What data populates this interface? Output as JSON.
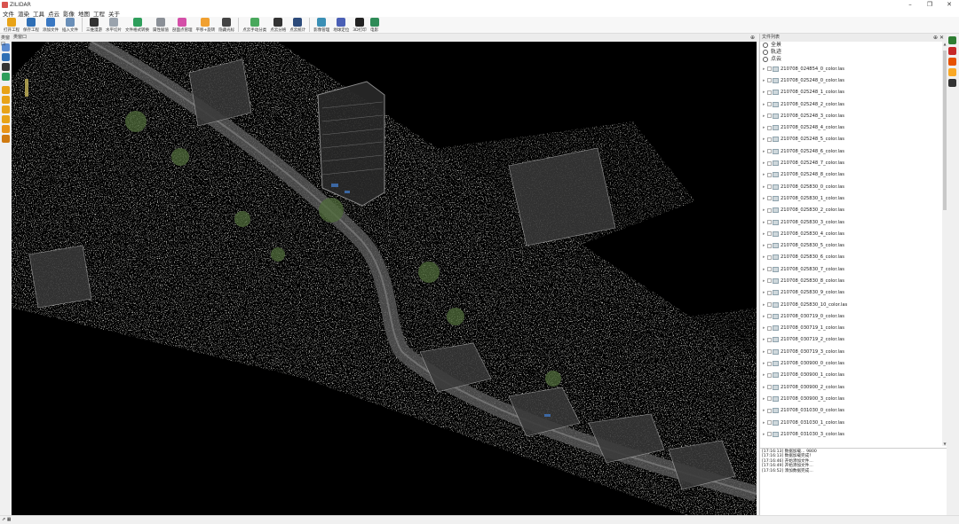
{
  "window": {
    "title": "ZILIDAR",
    "controls": [
      "–",
      "❐",
      "✕"
    ]
  },
  "menu": [
    "文件",
    "渲染",
    "工具",
    "点云",
    "影像",
    "地图",
    "工程",
    "关于"
  ],
  "toolbar": [
    {
      "label": "打开工程",
      "icon": "folder-open-icon",
      "color": "#e8a317"
    },
    {
      "label": "保存工程",
      "icon": "save-icon",
      "color": "#2f6fb5"
    },
    {
      "label": "添加文件",
      "icon": "add-file-icon",
      "color": "#3a78c2"
    },
    {
      "label": "插入文件",
      "icon": "insert-file-icon",
      "color": "#6a8fb8"
    },
    {
      "label": "三维漫游",
      "icon": "roam-icon",
      "color": "#333333"
    },
    {
      "label": "水平切片",
      "icon": "slice-icon",
      "color": "#9aa3ad"
    },
    {
      "label": "文件格式转换",
      "icon": "convert-icon",
      "color": "#2e9e5b"
    },
    {
      "label": "属性赋值",
      "icon": "attribute-icon",
      "color": "#8a8f96"
    },
    {
      "label": "剖面点管理",
      "icon": "profile-icon",
      "color": "#d44fa8"
    },
    {
      "label": "平移+旋转",
      "icon": "rotate-icon",
      "color": "#f0a030"
    },
    {
      "label": "隐藏光标",
      "icon": "hide-cursor-icon",
      "color": "#444444"
    },
    {
      "label": "点云手动分类",
      "icon": "classify-icon",
      "color": "#49a85c"
    },
    {
      "label": "点云分格",
      "icon": "grid-icon",
      "color": "#333333"
    },
    {
      "label": "点云统计",
      "icon": "stats-icon",
      "color": "#2c4a7a"
    },
    {
      "label": "影像管理",
      "icon": "image-icon",
      "color": "#3a8fb5"
    },
    {
      "label": "地球定位",
      "icon": "globe-icon",
      "color": "#4a5fb5"
    },
    {
      "label": "3D打印",
      "icon": "print-icon",
      "color": "#222222"
    },
    {
      "label": "电影",
      "icon": "movie-icon",
      "color": "#2e8b57"
    }
  ],
  "left_panel": {
    "tab_label": "类窗口"
  },
  "viewport": {
    "header_label": "类窗口"
  },
  "right_panel": {
    "title": "文件列表",
    "roots": [
      {
        "label": "全景",
        "icon": "panorama-icon"
      },
      {
        "label": "轨迹",
        "icon": "trajectory-icon"
      },
      {
        "label": "点云",
        "icon": "pointcloud-icon"
      }
    ],
    "files": [
      "210708_024854_0_color.las",
      "210708_025248_0_color.las",
      "210708_025248_1_color.las",
      "210708_025248_2_color.las",
      "210708_025248_3_color.las",
      "210708_025248_4_color.las",
      "210708_025248_5_color.las",
      "210708_025248_6_color.las",
      "210708_025248_7_color.las",
      "210708_025248_8_color.las",
      "210708_025830_0_color.las",
      "210708_025830_1_color.las",
      "210708_025830_2_color.las",
      "210708_025830_3_color.las",
      "210708_025830_4_color.las",
      "210708_025830_5_color.las",
      "210708_025830_6_color.las",
      "210708_025830_7_color.las",
      "210708_025830_8_color.las",
      "210708_025830_9_color.las",
      "210708_025830_10_color.las",
      "210708_030719_0_color.las",
      "210708_030719_1_color.las",
      "210708_030719_2_color.las",
      "210708_030719_3_color.las",
      "210708_030900_0_color.las",
      "210708_030900_1_color.las",
      "210708_030900_2_color.las",
      "210708_030900_3_color.las",
      "210708_031030_0_color.las",
      "210708_031030_1_color.las",
      "210708_031030_3_color.las"
    ]
  },
  "log": [
    "[17:16:13] 数据加载… 9800",
    "[17:16:13] 数据加载完成！",
    "[17:16:46] 开始添加文件…",
    "[17:16:49] 开始添加文件…",
    "[17:16:52] 添加数据完成…"
  ],
  "left_icons": [
    "view-top-icon",
    "globe-small-icon",
    "fit-icon",
    "zoom-icon",
    "cube-front-icon",
    "cube-back-icon",
    "cube-left-icon",
    "cube-right-icon",
    "cube-top-icon",
    "cube-bottom-icon"
  ],
  "right_icons": [
    "binocular-icon",
    "layer-red-icon",
    "layer-orange-icon",
    "layer-yellow-icon",
    "cross-icon"
  ]
}
